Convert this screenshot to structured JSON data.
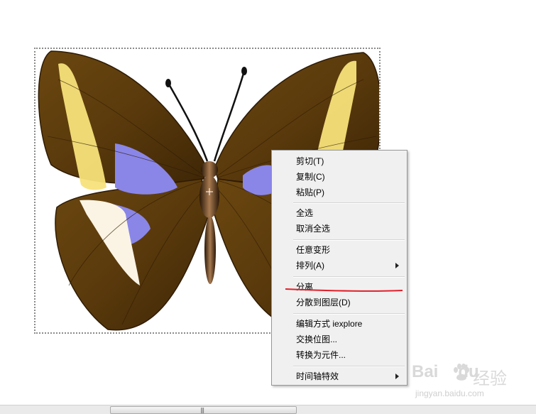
{
  "canvas": {
    "image_alt": "butterfly bitmap"
  },
  "context_menu": {
    "items": [
      {
        "label": "剪切(T)",
        "submenu": false
      },
      {
        "label": "复制(C)",
        "submenu": false
      },
      {
        "label": "粘贴(P)",
        "submenu": false
      },
      {
        "label": "全选",
        "submenu": false
      },
      {
        "label": "取消全选",
        "submenu": false
      },
      {
        "label": "任意变形",
        "submenu": false
      },
      {
        "label": "排列(A)",
        "submenu": true
      },
      {
        "label": "分离",
        "submenu": false,
        "highlighted_by_annotation": true
      },
      {
        "label": "分散到图层(D)",
        "submenu": false
      },
      {
        "label": "编辑方式 iexplore",
        "submenu": false
      },
      {
        "label": "交换位图...",
        "submenu": false
      },
      {
        "label": "转换为元件...",
        "submenu": false
      },
      {
        "label": "时间轴特效",
        "submenu": true
      }
    ]
  },
  "annotation": {
    "color": "#e0202a"
  },
  "watermark": {
    "logo_text": "Bai",
    "logo_text_2": "du",
    "brand_text": "经验",
    "url": "jingyan.baidu.com"
  },
  "colors": {
    "wing_brown": "#5a3a0c",
    "wing_yellow": "#f7e27a",
    "wing_blue": "#8a86e8",
    "menu_bg": "#f0f0f0"
  }
}
